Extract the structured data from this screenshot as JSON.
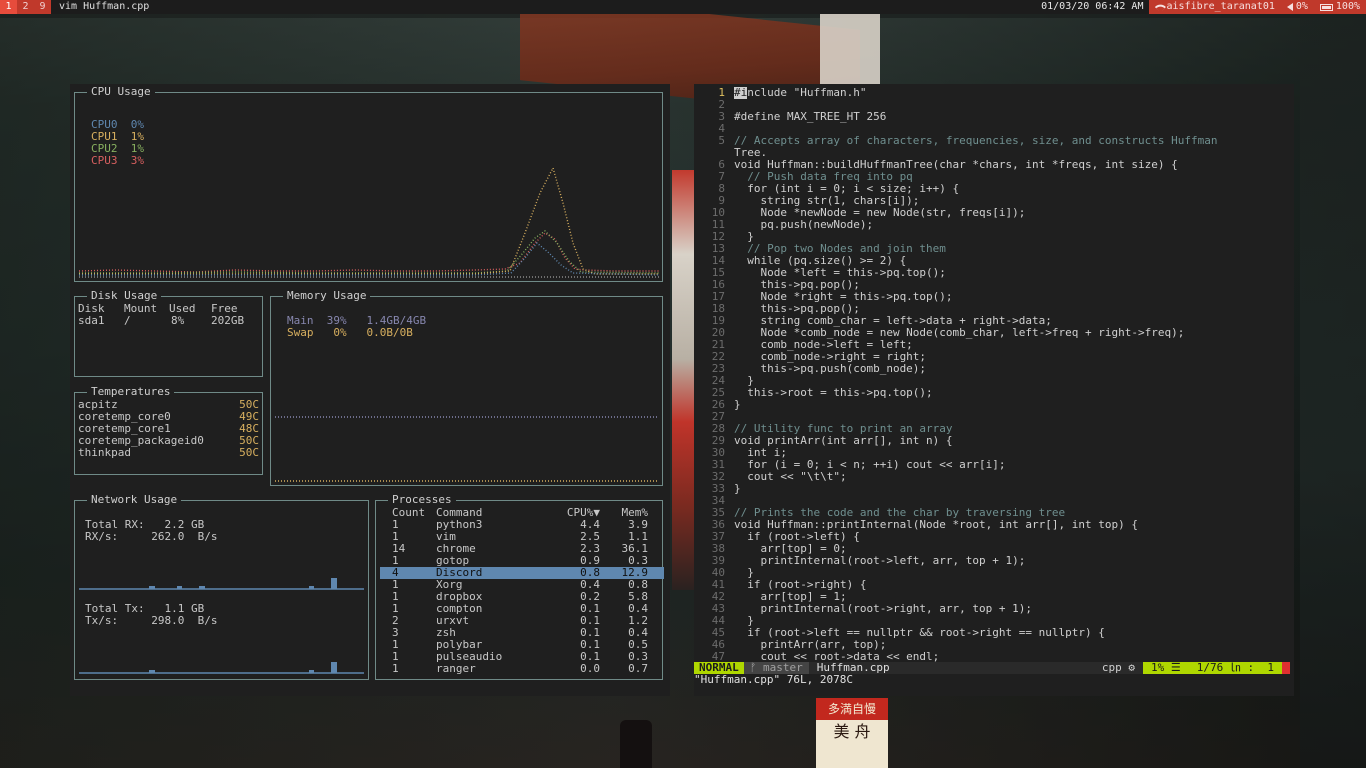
{
  "topbar": {
    "workspaces": [
      "1",
      "2",
      "9"
    ],
    "window_title": "vim Huffman.cpp",
    "clock": "01/03/20 06:42 AM",
    "network": "aisfibre_taranat01",
    "volume": "0%",
    "battery": "100%"
  },
  "cpu": {
    "title": "CPU Usage",
    "legend": [
      {
        "name": "CPU0",
        "value": "0%"
      },
      {
        "name": "CPU1",
        "value": "1%"
      },
      {
        "name": "CPU2",
        "value": "1%"
      },
      {
        "name": "CPU3",
        "value": "3%"
      }
    ]
  },
  "disk": {
    "title": "Disk Usage",
    "headers": [
      "Disk",
      "Mount",
      "Used",
      "Free"
    ],
    "rows": [
      [
        "sda1",
        "/",
        "8%",
        "202GB"
      ]
    ]
  },
  "memory": {
    "title": "Memory Usage",
    "main_label": "Main",
    "main_pct": "39%",
    "main_amount": "1.4GB/4GB",
    "swap_label": "Swap",
    "swap_pct": "0%",
    "swap_amount": "0.0B/0B"
  },
  "temps": {
    "title": "Temperatures",
    "rows": [
      {
        "name": "acpitz",
        "value": "50C"
      },
      {
        "name": "coretemp_core0",
        "value": "49C"
      },
      {
        "name": "coretemp_core1",
        "value": "48C"
      },
      {
        "name": "coretemp_packageid0",
        "value": "50C"
      },
      {
        "name": "thinkpad",
        "value": "50C"
      }
    ]
  },
  "network_usage": {
    "title": "Network Usage",
    "total_rx_label": "Total RX:",
    "total_rx": "2.2 GB",
    "rx_rate_label": "RX/s:",
    "rx_rate": "262.0  B/s",
    "total_tx_label": "Total Tx:",
    "total_tx": "1.1 GB",
    "tx_rate_label": "Tx/s:",
    "tx_rate": "298.0  B/s"
  },
  "processes": {
    "title": "Processes",
    "headers": [
      "Count",
      "Command",
      "CPU%▼",
      "Mem%"
    ],
    "selected_index": 4,
    "rows": [
      [
        "1",
        "python3",
        "4.4",
        "3.9"
      ],
      [
        "1",
        "vim",
        "2.5",
        "1.1"
      ],
      [
        "14",
        "chrome",
        "2.3",
        "36.1"
      ],
      [
        "1",
        "gotop",
        "0.9",
        "0.3"
      ],
      [
        "4",
        "Discord",
        "0.8",
        "12.9"
      ],
      [
        "1",
        "Xorg",
        "0.4",
        "0.8"
      ],
      [
        "1",
        "dropbox",
        "0.2",
        "5.8"
      ],
      [
        "1",
        "compton",
        "0.1",
        "0.4"
      ],
      [
        "2",
        "urxvt",
        "0.1",
        "1.2"
      ],
      [
        "3",
        "zsh",
        "0.1",
        "0.4"
      ],
      [
        "1",
        "polybar",
        "0.1",
        "0.5"
      ],
      [
        "1",
        "pulseaudio",
        "0.1",
        "0.3"
      ],
      [
        "1",
        "ranger",
        "0.0",
        "0.7"
      ]
    ]
  },
  "vim": {
    "lines": [
      [
        "1",
        "#include \"Huffman.h\""
      ],
      [
        "2",
        ""
      ],
      [
        "3",
        "#define MAX_TREE_HT 256"
      ],
      [
        "4",
        ""
      ],
      [
        "5",
        "// Accepts array of characters, frequencies, size, and constructs Huffman"
      ],
      [
        "",
        "Tree."
      ],
      [
        "6",
        "void Huffman::buildHuffmanTree(char *chars, int *freqs, int size) {"
      ],
      [
        "7",
        "  // Push data freq into pq"
      ],
      [
        "8",
        "  for (int i = 0; i < size; i++) {"
      ],
      [
        "9",
        "    string str(1, chars[i]);"
      ],
      [
        "10",
        "    Node *newNode = new Node(str, freqs[i]);"
      ],
      [
        "11",
        "    pq.push(newNode);"
      ],
      [
        "12",
        "  }"
      ],
      [
        "13",
        "  // Pop two Nodes and join them"
      ],
      [
        "14",
        "  while (pq.size() >= 2) {"
      ],
      [
        "15",
        "    Node *left = this->pq.top();"
      ],
      [
        "16",
        "    this->pq.pop();"
      ],
      [
        "17",
        "    Node *right = this->pq.top();"
      ],
      [
        "18",
        "    this->pq.pop();"
      ],
      [
        "19",
        "    string comb_char = left->data + right->data;"
      ],
      [
        "20",
        "    Node *comb_node = new Node(comb_char, left->freq + right->freq);"
      ],
      [
        "21",
        "    comb_node->left = left;"
      ],
      [
        "22",
        "    comb_node->right = right;"
      ],
      [
        "23",
        "    this->pq.push(comb_node);"
      ],
      [
        "24",
        "  }"
      ],
      [
        "25",
        "  this->root = this->pq.top();"
      ],
      [
        "26",
        "}"
      ],
      [
        "27",
        ""
      ],
      [
        "28",
        "// Utility func to print an array"
      ],
      [
        "29",
        "void printArr(int arr[], int n) {"
      ],
      [
        "30",
        "  int i;"
      ],
      [
        "31",
        "  for (i = 0; i < n; ++i) cout << arr[i];"
      ],
      [
        "32",
        "  cout << \"\\t\\t\";"
      ],
      [
        "33",
        "}"
      ],
      [
        "34",
        ""
      ],
      [
        "35",
        "// Prints the code and the char by traversing tree"
      ],
      [
        "36",
        "void Huffman::printInternal(Node *root, int arr[], int top) {"
      ],
      [
        "37",
        "  if (root->left) {"
      ],
      [
        "38",
        "    arr[top] = 0;"
      ],
      [
        "39",
        "    printInternal(root->left, arr, top + 1);"
      ],
      [
        "40",
        "  }"
      ],
      [
        "41",
        "  if (root->right) {"
      ],
      [
        "42",
        "    arr[top] = 1;"
      ],
      [
        "43",
        "    printInternal(root->right, arr, top + 1);"
      ],
      [
        "44",
        "  }"
      ],
      [
        "45",
        "  if (root->left == nullptr && root->right == nullptr) {"
      ],
      [
        "46",
        "    printArr(arr, top);"
      ],
      [
        "47",
        "    cout << root->data << endl;"
      ]
    ],
    "status": {
      "mode": "NORMAL",
      "branch": "master",
      "file": "Huffman.cpp",
      "filetype": "cpp",
      "percent": "1% ☰",
      "position": "1/76 ㏑ :  1"
    },
    "cmdline": "\"Huffman.cpp\" 76L, 2078C"
  },
  "wallpaper": {
    "sign_top": "多満自慢",
    "sign_bottom": "美 舟"
  }
}
